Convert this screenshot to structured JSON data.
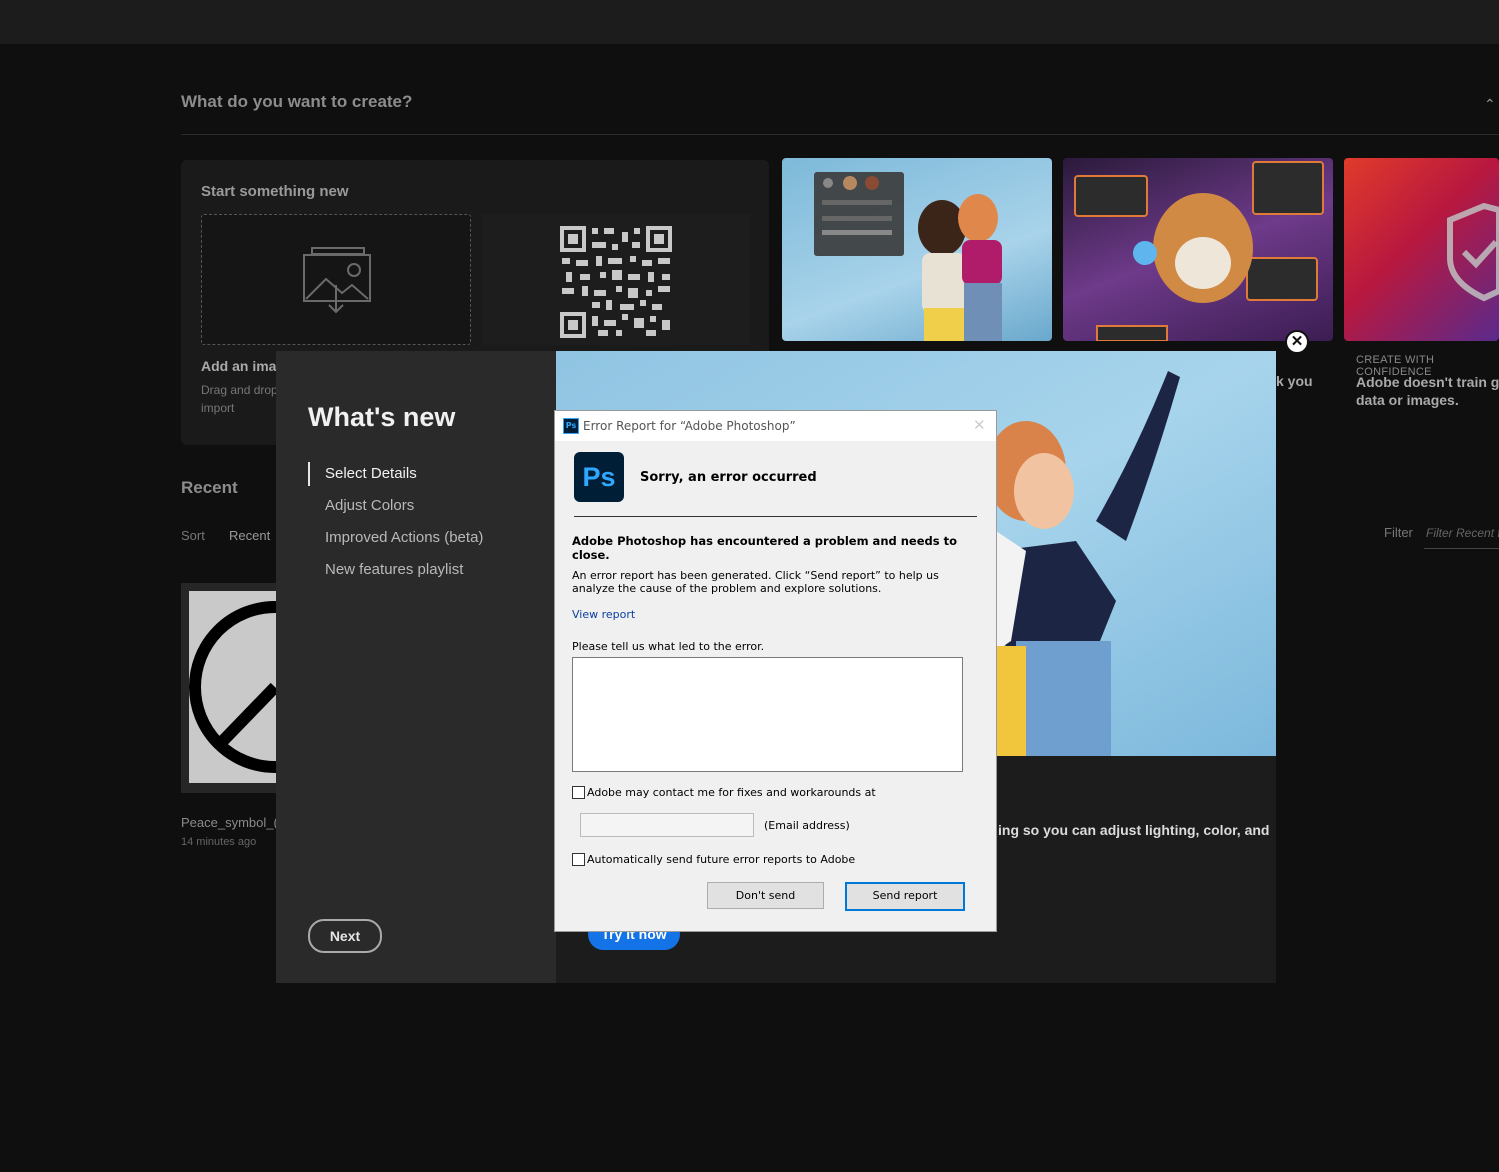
{
  "home": {
    "section_title": "What do you want to create?",
    "collapse_icon": "chevron-up-icon",
    "start": {
      "title": "Start something new",
      "add_image_label": "Add an imag",
      "drag_text_1": "Drag and drop a",
      "drag_text_2": "import"
    },
    "card_caption_2": "k you",
    "card_3": {
      "tag": "CREATE WITH CONFIDENCE",
      "line1": "Adobe doesn't train gene",
      "line2": "data or images."
    },
    "recent": {
      "title": "Recent",
      "sort_label": "Sort",
      "sort_value": "Recent",
      "filter_label": "Filter",
      "filter_placeholder": "Filter Recent f",
      "file_name": "Peace_symbol_(",
      "file_time": "14 minutes ago"
    }
  },
  "whats_new": {
    "title": "What's new",
    "nav": [
      "Select Details",
      "Adjust Colors",
      "Improved Actions (beta)",
      "New features playlist"
    ],
    "active_index": 0,
    "next_label": "Next",
    "hero_text": "ing so you can adjust lighting, color, and",
    "try_label": "Try it now",
    "close_icon": "close-icon"
  },
  "error_dialog": {
    "window_title": "Error Report for “Adobe Photoshop”",
    "app_icon_text": "Ps",
    "heading": "Sorry, an error occurred",
    "problem": "Adobe Photoshop has encountered a problem and needs to close.",
    "description": "An error report has been generated. Click “Send report” to help us analyze the cause of the problem and explore solutions.",
    "view_report": "View report",
    "tell_us": "Please tell us what led to the error.",
    "comment_value": "",
    "contact_label": "Adobe may contact me for fixes and workarounds at",
    "email_value": "",
    "email_label": "(Email address)",
    "auto_send_label": "Automatically send future error reports to Adobe",
    "dont_send": "Don't send",
    "send_report": "Send report"
  }
}
